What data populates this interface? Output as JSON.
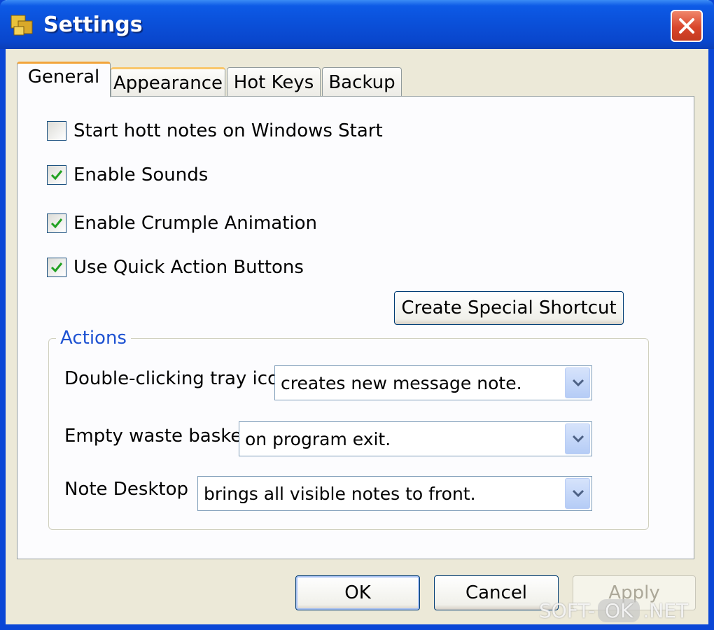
{
  "window": {
    "title": "Settings"
  },
  "tabs": [
    {
      "label": "General"
    },
    {
      "label": "Appearance"
    },
    {
      "label": "Hot Keys"
    },
    {
      "label": "Backup"
    }
  ],
  "general": {
    "checkboxes": [
      {
        "label": "Start hott notes on Windows Start",
        "checked": false
      },
      {
        "label": "Enable Sounds",
        "checked": true
      },
      {
        "label": "Enable Crumple Animation",
        "checked": true
      },
      {
        "label": "Use Quick Action Buttons",
        "checked": true
      }
    ],
    "special_shortcut_label": "Create Special Shortcut",
    "actions": {
      "legend": "Actions",
      "rows": [
        {
          "label": "Double-clicking tray icon",
          "value": "creates new message note."
        },
        {
          "label": "Empty waste basket",
          "value": "on program exit."
        },
        {
          "label": "Note Desktop",
          "value": "brings all visible notes to front."
        }
      ]
    }
  },
  "footer": {
    "ok_label": "OK",
    "cancel_label": "Cancel",
    "apply_label": "Apply"
  },
  "watermark": {
    "left": "SOFT-",
    "middle": "OK",
    "right": ".NET"
  },
  "colors": {
    "title_bar": "#0a4fd8",
    "close_button": "#d9462c",
    "tab_accent": "#f2a43b",
    "group_legend": "#1e52d2",
    "checkmark": "#21a121"
  },
  "icons": {
    "app": "notes-app-icon",
    "close": "close-icon",
    "check": "checkmark-icon",
    "dropdown": "chevron-down-icon"
  }
}
